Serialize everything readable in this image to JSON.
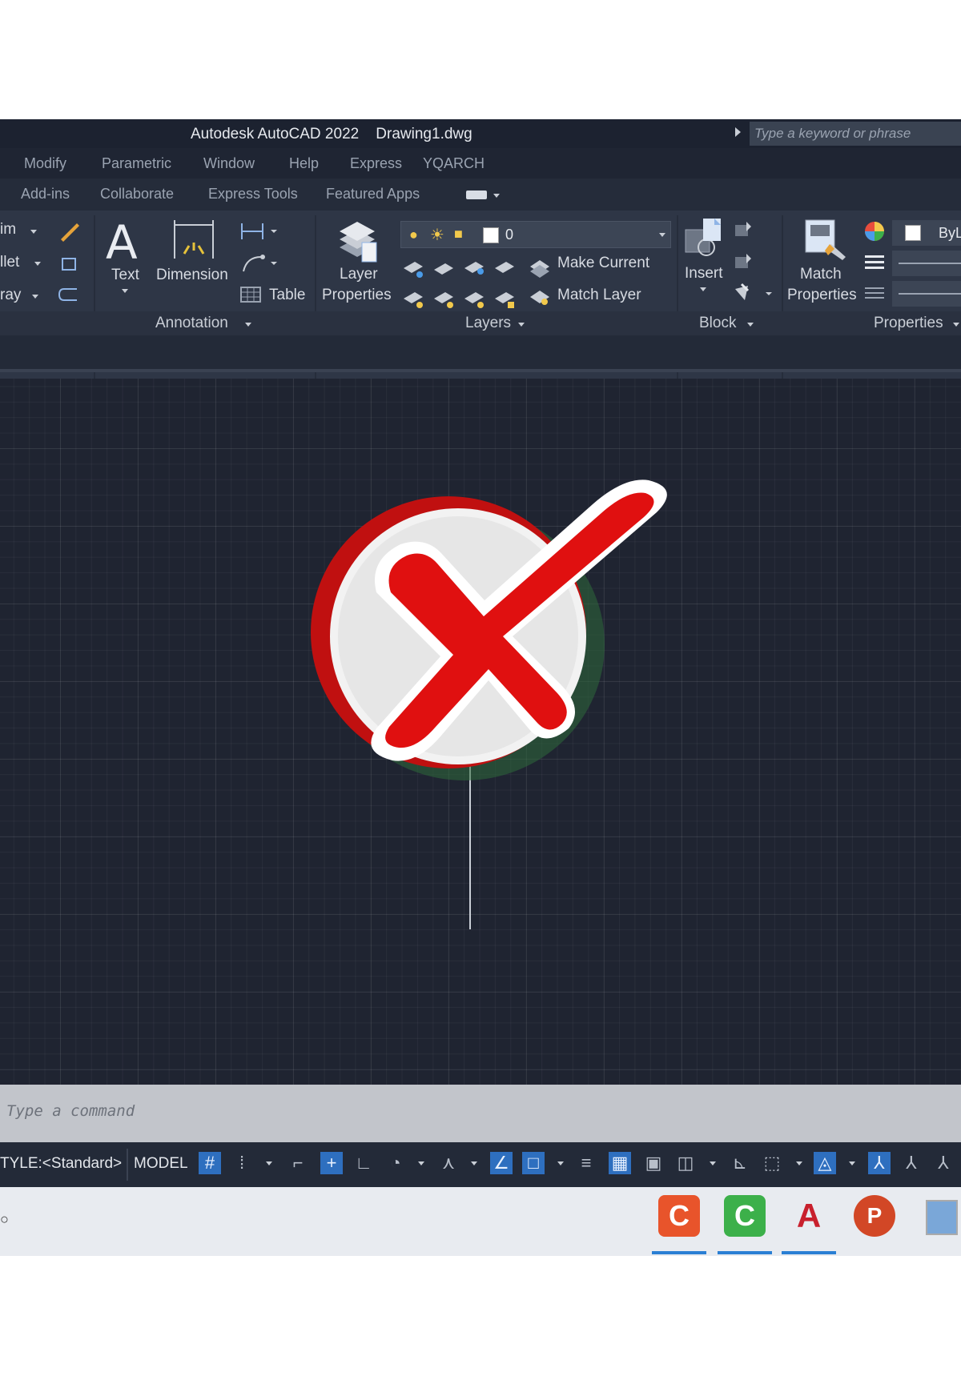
{
  "window": {
    "title": "Autodesk AutoCAD 2022    Drawing1.dwg",
    "search_placeholder": "Type a keyword or phrase"
  },
  "menu": [
    "Modify",
    "Parametric",
    "Window",
    "Help",
    "Express",
    "YQARCH"
  ],
  "ribbon_tabs": [
    "Add-ins",
    "Collaborate",
    "Express Tools",
    "Featured Apps"
  ],
  "modify_panel": {
    "items": [
      "im",
      "llet",
      "ray"
    ]
  },
  "annotation_panel": {
    "text_label": "Text",
    "dimension_label": "Dimension",
    "table_label": "Table",
    "footer": "Annotation"
  },
  "layers_panel": {
    "layer_properties_line1": "Layer",
    "layer_properties_line2": "Properties",
    "current_layer": "0",
    "make_current": "Make Current",
    "match_layer": "Match Layer",
    "footer": "Layers"
  },
  "block_panel": {
    "insert_label": "Insert",
    "footer": "Block"
  },
  "properties_panel": {
    "match_line1": "Match",
    "match_line2": "Properties",
    "bylayer": "ByL",
    "footer": "Properties"
  },
  "command_line": {
    "placeholder": "Type a command"
  },
  "status_bar": {
    "style": "TYLE:<Standard>",
    "model": "MODEL"
  },
  "taskbar": {
    "apps": [
      {
        "name": "camtasia-recorder",
        "letter": "C",
        "color": "#e8542b"
      },
      {
        "name": "camtasia-editor",
        "letter": "C",
        "color": "#3cb04a"
      },
      {
        "name": "autocad",
        "letter": "A",
        "color": "#c8202d"
      },
      {
        "name": "powerpoint",
        "letter": "P",
        "color": "#d24726"
      }
    ]
  },
  "overlay": {
    "icon": "red-x-cross-icon",
    "accent": "#e01010"
  }
}
